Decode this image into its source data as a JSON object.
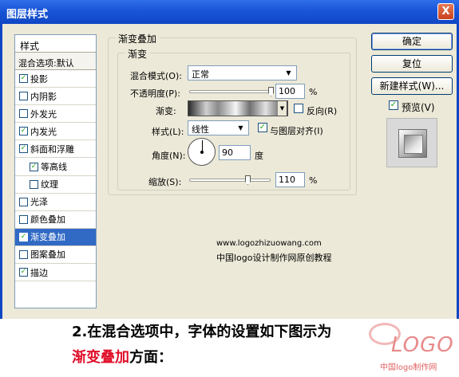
{
  "window": {
    "title": "图层样式",
    "close_glyph": "X"
  },
  "style_list": {
    "header": "样式",
    "blend_options": "混合选项:默认",
    "items": [
      {
        "label": "投影",
        "checked": true,
        "sub": false,
        "selected": false
      },
      {
        "label": "内阴影",
        "checked": false,
        "sub": false,
        "selected": false
      },
      {
        "label": "外发光",
        "checked": false,
        "sub": false,
        "selected": false
      },
      {
        "label": "内发光",
        "checked": true,
        "sub": false,
        "selected": false
      },
      {
        "label": "斜面和浮雕",
        "checked": true,
        "sub": false,
        "selected": false
      },
      {
        "label": "等高线",
        "checked": true,
        "sub": true,
        "selected": false
      },
      {
        "label": "纹理",
        "checked": false,
        "sub": true,
        "selected": false
      },
      {
        "label": "光泽",
        "checked": false,
        "sub": false,
        "selected": false
      },
      {
        "label": "颜色叠加",
        "checked": false,
        "sub": false,
        "selected": false
      },
      {
        "label": "渐变叠加",
        "checked": true,
        "sub": false,
        "selected": true
      },
      {
        "label": "图案叠加",
        "checked": false,
        "sub": false,
        "selected": false
      },
      {
        "label": "描边",
        "checked": true,
        "sub": false,
        "selected": false
      }
    ]
  },
  "panel": {
    "outer_title": "渐变叠加",
    "inner_title": "渐变",
    "blend_mode_label": "混合模式(O):",
    "blend_mode_value": "正常",
    "opacity_label": "不透明度(P):",
    "opacity_value": "100",
    "opacity_unit": "%",
    "opacity_level": 1.0,
    "gradient_label": "渐变:",
    "reverse_label": "反向(R)",
    "reverse_checked": false,
    "style_label": "样式(L):",
    "style_value": "线性",
    "align_label": "与图层对齐(I)",
    "align_checked": true,
    "angle_label": "角度(N):",
    "angle_value": "90",
    "angle_unit": "度",
    "scale_label": "缩放(S):",
    "scale_value": "110",
    "scale_unit": "%",
    "scale_level": 0.73
  },
  "buttons": {
    "ok": "确定",
    "reset": "复位",
    "new_style": "新建样式(W)...",
    "preview_label": "预览(V)",
    "preview_checked": true
  },
  "watermark": {
    "url": "www.logozhizuowang.com",
    "text": "中国logo设计制作网原创教程"
  },
  "caption": {
    "line1": "2.在混合选项中，字体的设置如下图示为",
    "line2_highlight": "渐变叠加",
    "line2_rest": "方面：",
    "highlight_color": "#e0102a"
  },
  "logo": {
    "text": "LOGO",
    "sub": "中国logo制作网"
  },
  "colors": {
    "titlebar": "#1a55d8",
    "selection": "#316ac5",
    "dialog_bg": "#ece9d8"
  },
  "icons": {
    "checkmark": "check-icon",
    "dropdown": "chevron-down-icon",
    "close": "close-icon"
  }
}
